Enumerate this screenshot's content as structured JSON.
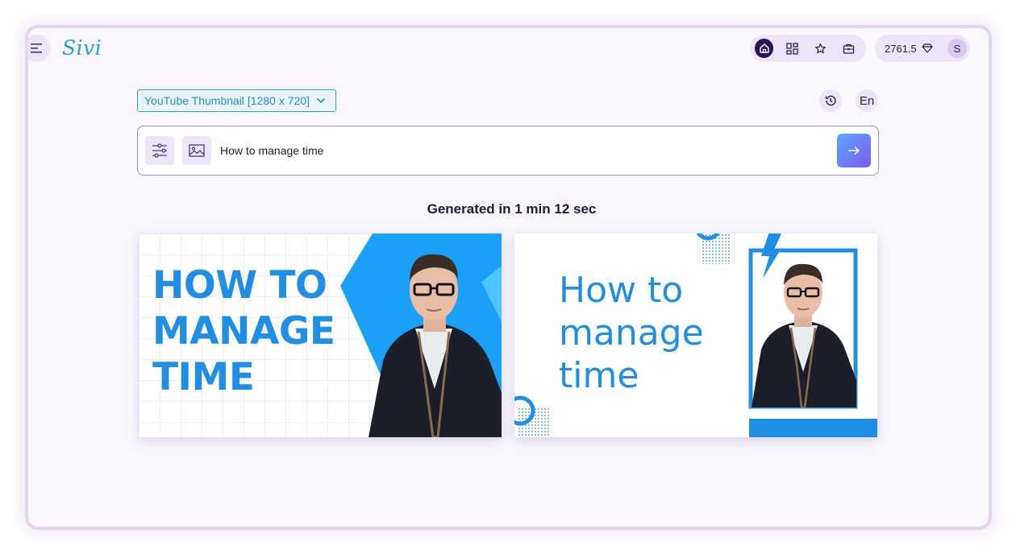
{
  "app": {
    "logo_text": "Sivi"
  },
  "topbar": {
    "nav_icons": [
      "home-icon",
      "grid-icon",
      "star-icon",
      "briefcase-icon"
    ],
    "credits": "2761.5",
    "credits_icon": "diamond-icon",
    "avatar_initial": "S"
  },
  "toolbar": {
    "format_label": "YouTube Thumbnail [1280 x 720]",
    "language_label": "En"
  },
  "prompt": {
    "value": "How to manage time"
  },
  "results": {
    "status": "Generated in 1 min 12 sec",
    "thumbnails": [
      {
        "lines": [
          "HOW TO",
          "MANAGE",
          "TIME"
        ]
      },
      {
        "lines": [
          "How to",
          "manage",
          "time"
        ]
      }
    ]
  },
  "colors": {
    "accent": "#1f8fe5",
    "frame": "#e3d4f6",
    "dark": "#2a1452"
  }
}
